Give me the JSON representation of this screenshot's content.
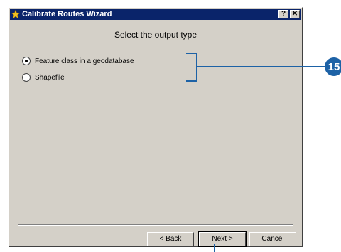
{
  "window": {
    "title": "Calibrate Routes Wizard",
    "help_button": "?",
    "close_button": "✕"
  },
  "page": {
    "heading": "Select the output type"
  },
  "options": [
    {
      "label": "Feature class in a geodatabase",
      "selected": true
    },
    {
      "label": "Shapefile",
      "selected": false
    }
  ],
  "buttons": {
    "back": "< Back",
    "next": "Next >",
    "cancel": "Cancel"
  },
  "callout": {
    "number": "15",
    "color": "#1d62a6"
  }
}
